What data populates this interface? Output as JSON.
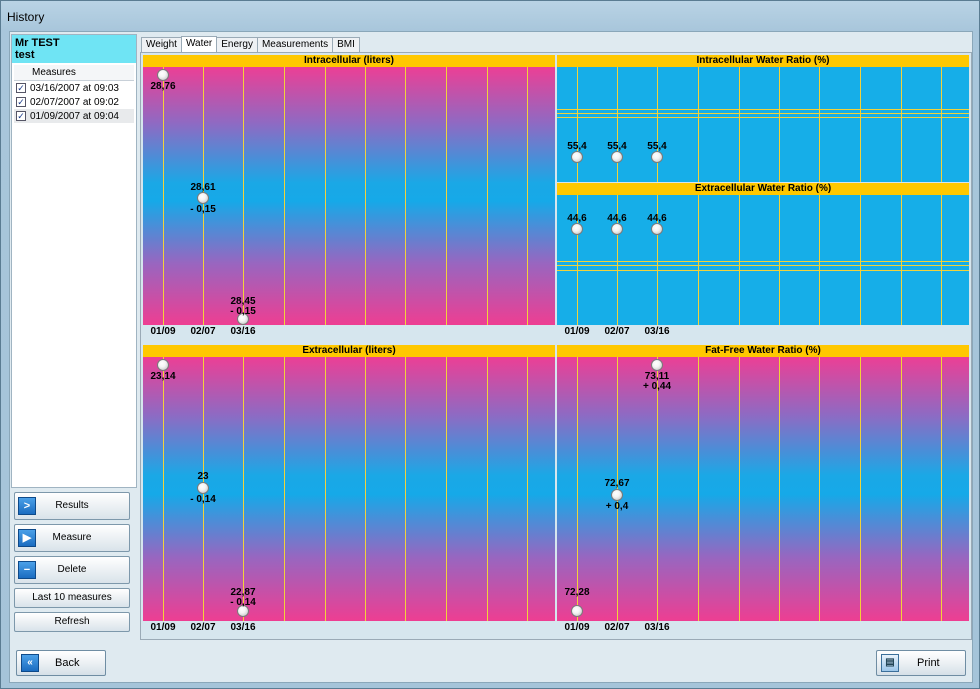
{
  "window": {
    "title": "History"
  },
  "user": {
    "name": "Mr TEST",
    "sub": "test"
  },
  "measures": {
    "header": "Measures",
    "items": [
      {
        "label": "03/16/2007 at 09:03",
        "checked": true
      },
      {
        "label": "02/07/2007 at 09:02",
        "checked": true
      },
      {
        "label": "01/09/2007 at 09:04",
        "checked": true
      }
    ]
  },
  "side_buttons": {
    "results": "Results",
    "measure": "Measure",
    "delete": "Delete",
    "last10": "Last 10 measures",
    "refresh": "Refresh"
  },
  "tabs": [
    "Weight",
    "Water",
    "Energy",
    "Measurements",
    "BMI"
  ],
  "active_tab": "Water",
  "panels": {
    "intracellular": {
      "title": "Intracellular (liters)",
      "dates": [
        "01/09",
        "02/07",
        "03/16"
      ],
      "values": [
        "28,76",
        "28,61",
        "28,45"
      ],
      "deltas": [
        "",
        "- 0,15",
        "- 0,15"
      ]
    },
    "icw_ratio": {
      "title": "Intracellular Water Ratio (%)",
      "values": [
        "55,4",
        "55,4",
        "55,4"
      ]
    },
    "ecw_ratio": {
      "title": "Extracellular Water Ratio (%)",
      "dates": [
        "01/09",
        "02/07",
        "03/16"
      ],
      "values": [
        "44,6",
        "44,6",
        "44,6"
      ]
    },
    "extracellular": {
      "title": "Extracellular (liters)",
      "dates": [
        "01/09",
        "02/07",
        "03/16"
      ],
      "values": [
        "23,14",
        "23",
        "22,87"
      ],
      "deltas": [
        "",
        "- 0,14",
        "- 0,14"
      ]
    },
    "ffw_ratio": {
      "title": "Fat-Free Water Ratio (%)",
      "dates": [
        "01/09",
        "02/07",
        "03/16"
      ],
      "values": [
        "72,28",
        "72,67",
        "73,11"
      ],
      "deltas": [
        "",
        "+ 0,4",
        "+ 0,44"
      ]
    }
  },
  "bottom": {
    "back": "Back",
    "print": "Print"
  },
  "colors": {
    "title_bar": "#ffc800",
    "gradient_pink": "#ec3f95",
    "gradient_cyan": "#1aa8e6",
    "user_box": "#6fe4f4"
  },
  "icons": {
    "results": "chevron-right-icon",
    "measure": "play-icon",
    "delete": "minus-icon",
    "back": "double-chevron-left-icon",
    "print": "document-icon"
  }
}
